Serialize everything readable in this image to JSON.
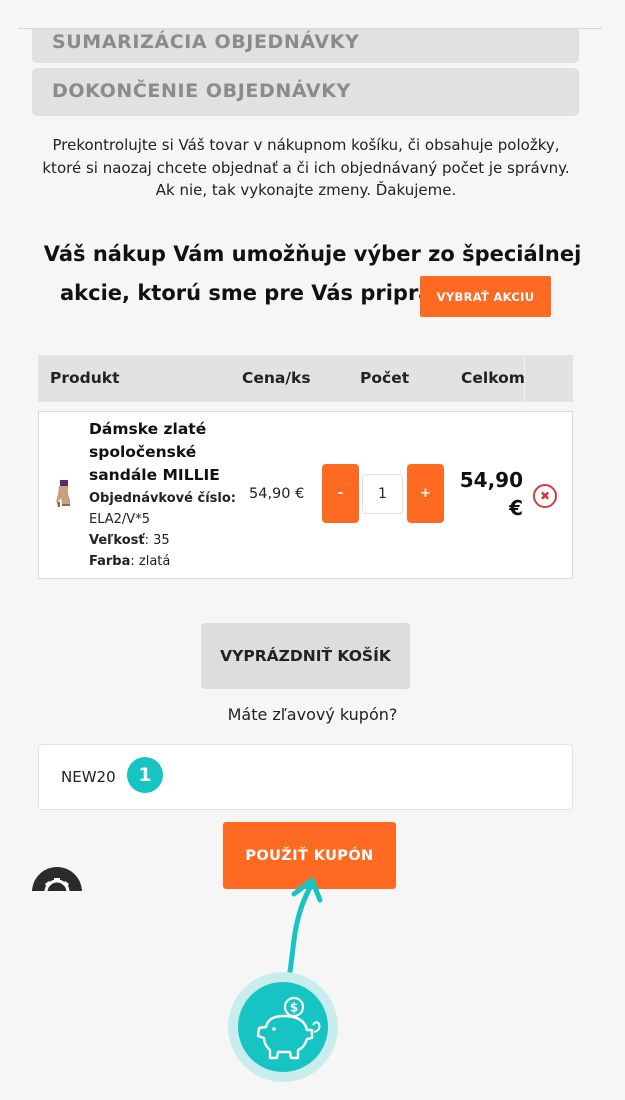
{
  "steps": {
    "summary": "SUMARIZÁCIA OBJEDNÁVKY",
    "finish": "DOKONČENIE OBJEDNÁVKY"
  },
  "info": {
    "line1": "Prekontrolujte si Váš tovar v nákupnom košíku, či obsahuje položky,",
    "line2": "ktoré si naozaj chcete objednať a či ich objednávaný počet je správny.",
    "line3": "Ak nie, tak vykonajte zmeny. Ďakujeme."
  },
  "promo": {
    "line1": "Váš nákup Vám umožňuje výber zo špeciálnej",
    "line2": "akcie, ktorú sme pre Vás pripravili.",
    "button": "VYBRAŤ AKCIU"
  },
  "table": {
    "headers": [
      "Produkt",
      "Cena/ks",
      "Počet",
      "Celkom"
    ]
  },
  "item": {
    "name_line1": "Dámske zlaté",
    "name_line2": "spoločenské",
    "name_line3": "sandále MILLIE",
    "order_label": "Objednávkové číslo:",
    "order_value": "ELA2/V*5",
    "size_label": "Veľkosť",
    "size_value": ": 35",
    "color_label": "Farba",
    "color_value": ": zlatá",
    "price": "54,90 €",
    "minus": "-",
    "qty": "1",
    "plus": "+",
    "total_line1": "54,90",
    "total_line2": "€",
    "remove": "✖"
  },
  "cart": {
    "empty_button": "VYPRÁZDNIŤ KOŠÍK",
    "coupon_question": "Máte zľavový kupón?",
    "coupon_value": "NEW20",
    "coupon_marker": "1",
    "coupon_button": "POUŽIŤ KUPÓN"
  },
  "icons": {
    "settings": "gear-icon",
    "savings": "piggy-bank-icon",
    "pointer": "arrow-icon",
    "remove": "remove-icon"
  },
  "colors": {
    "accent": "#ff6a23",
    "marker": "#16c4c4",
    "remove": "#d23c3c",
    "step_bg": "#e1e1e1"
  }
}
